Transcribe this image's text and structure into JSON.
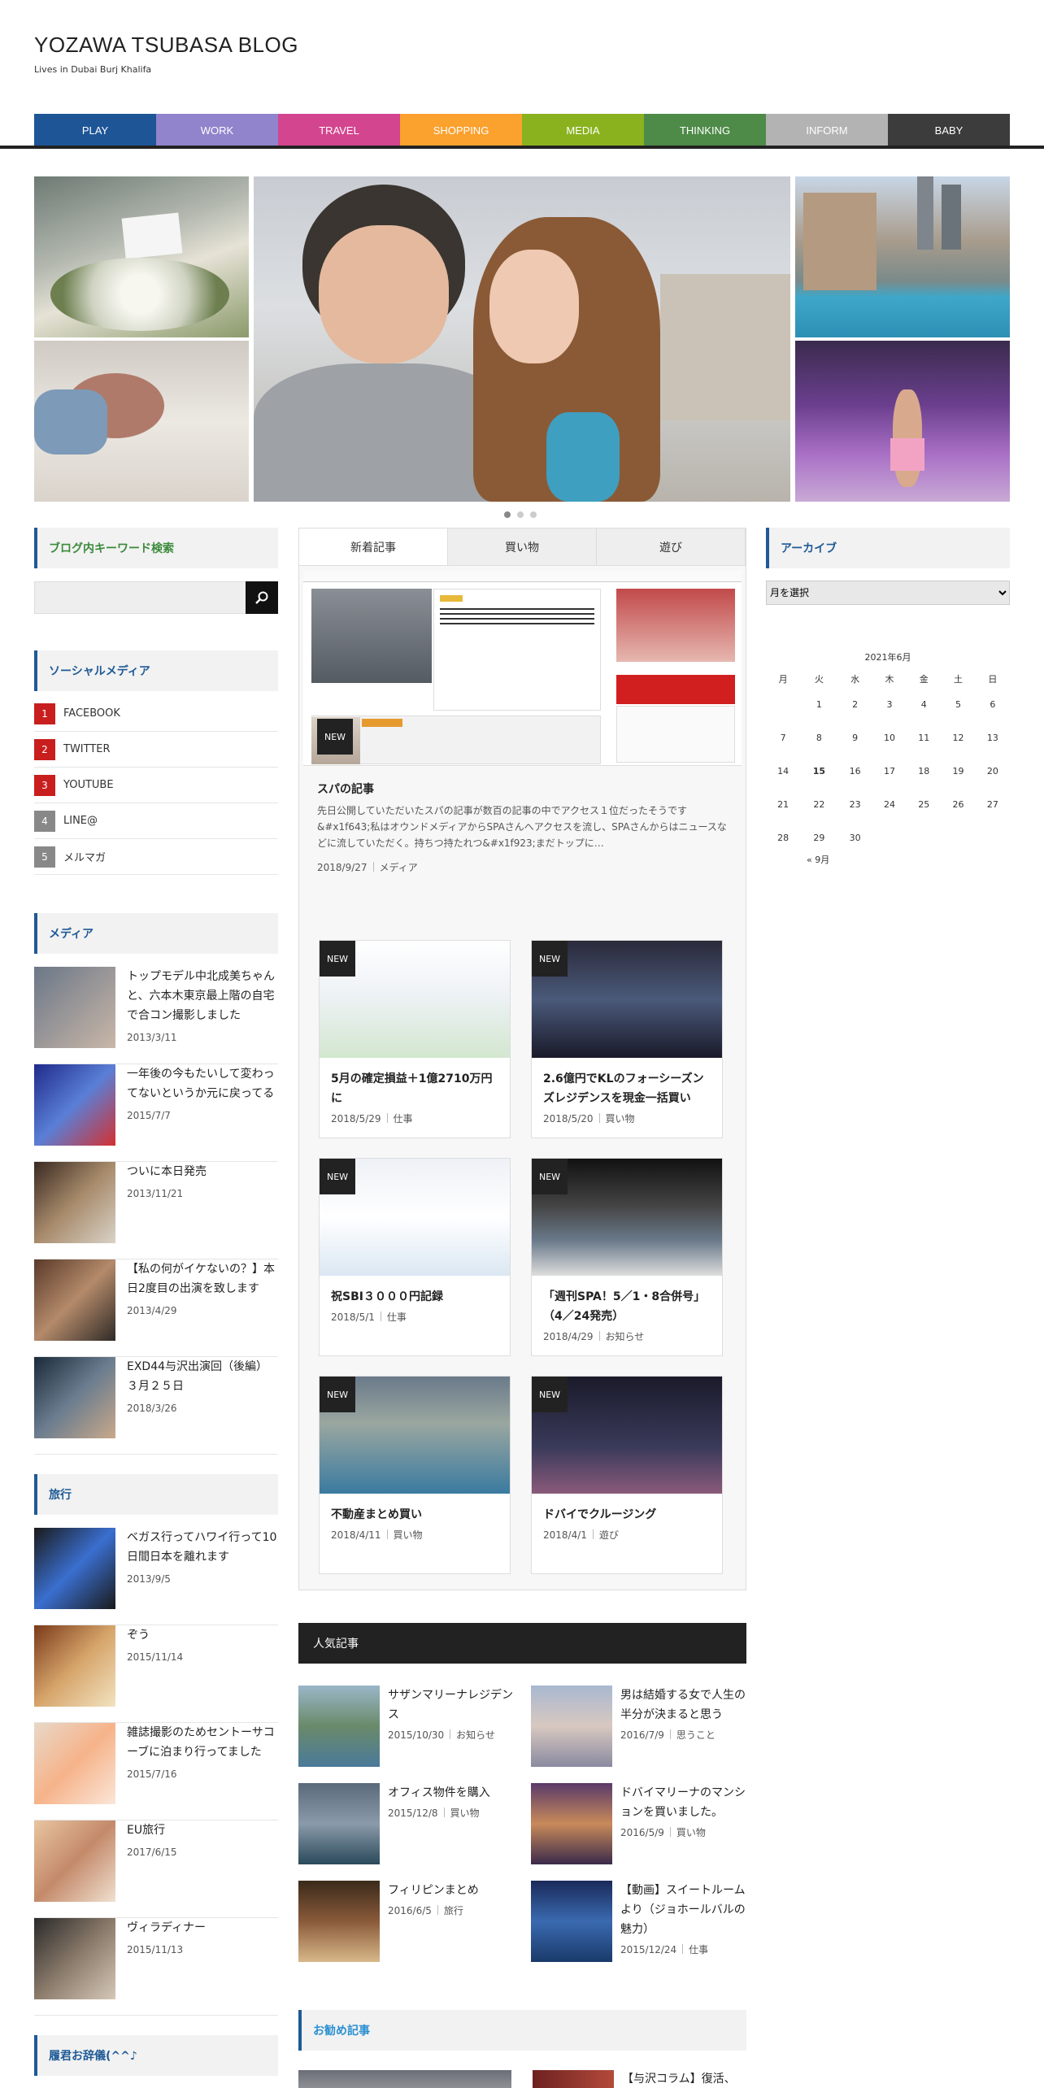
{
  "site": {
    "title": "YOZAWA TSUBASA BLOG",
    "tagline": "Lives in Dubai Burj Khalifa"
  },
  "nav": [
    {
      "label": "PLAY",
      "color": "#1e5596"
    },
    {
      "label": "WORK",
      "color": "#9184cc"
    },
    {
      "label": "TRAVEL",
      "color": "#d4458f"
    },
    {
      "label": "SHOPPING",
      "color": "#fba12e"
    },
    {
      "label": "MEDIA",
      "color": "#8ab21e"
    },
    {
      "label": "THINKING",
      "color": "#4e8a48"
    },
    {
      "label": "INFORM",
      "color": "#b3b3b3"
    },
    {
      "label": "BABY",
      "color": "#3c3c3c"
    }
  ],
  "slider": {
    "dots": 3,
    "active": 0
  },
  "search": {
    "title": "ブログ内キーワード検索",
    "placeholder": "",
    "button_icon": "search-icon"
  },
  "social": {
    "title": "ソーシャルメディア",
    "items": [
      {
        "num": "1",
        "label": "FACEBOOK",
        "color": "#c81e1e"
      },
      {
        "num": "2",
        "label": "TWITTER",
        "color": "#c81e1e"
      },
      {
        "num": "3",
        "label": "YOUTUBE",
        "color": "#c81e1e"
      },
      {
        "num": "4",
        "label": "LINE@",
        "color": "#888888"
      },
      {
        "num": "5",
        "label": "メルマガ",
        "color": "#888888"
      }
    ]
  },
  "media": {
    "title": "メディア",
    "items": [
      {
        "title": "トップモデル中北成美ちゃんと、六本木東京最上階の自宅で合コン撮影しました",
        "date": "2013/3/11"
      },
      {
        "title": "一年後の今もたいして変わってないというか元に戻ってる",
        "date": "2015/7/7"
      },
      {
        "title": "ついに本日発売",
        "date": "2013/11/21"
      },
      {
        "title": "【私の何がイケないの？】本日2度目の出演を致します",
        "date": "2013/4/29"
      },
      {
        "title": "EXD44与沢出演回（後編）３月２５日",
        "date": "2018/3/26"
      }
    ]
  },
  "travel": {
    "title": "旅行",
    "items": [
      {
        "title": "ベガス行ってハワイ行って10日間日本を離れます",
        "date": "2013/9/5"
      },
      {
        "title": "ぞう",
        "date": "2015/11/14"
      },
      {
        "title": "雑誌撮影のためセントーサコーブに泊まり行ってました",
        "date": "2015/7/16"
      },
      {
        "title": "EU旅行",
        "date": "2017/6/15"
      },
      {
        "title": "ヴィラディナー",
        "date": "2015/11/13"
      }
    ]
  },
  "bottom_left": {
    "title": "履君お辞儀(^^♪"
  },
  "tabs": [
    {
      "label": "新着記事",
      "active": true
    },
    {
      "label": "買い物",
      "active": false
    },
    {
      "label": "遊び",
      "active": false
    }
  ],
  "featured": {
    "badge": "NEW",
    "title": "スパの記事",
    "excerpt": "先日公開していただいたスパの記事が数百の記事の中でアクセス１位だったそうです &#x1f643;私はオウンドメディアからSPAさんへアクセスを流し、SPAさんからはニュースなどに流していただく。持ちつ持たれつ&#x1f923;まだトップに…",
    "date": "2018/9/27",
    "category": "メディア"
  },
  "cards": [
    {
      "badge": "NEW",
      "title": "5月の確定損益＋1億2710万円に",
      "date": "2018/5/29",
      "category": "仕事"
    },
    {
      "badge": "NEW",
      "title": "2.6億円でKLのフォーシーズンズレジデンスを現金一括買い",
      "date": "2018/5/20",
      "category": "買い物"
    },
    {
      "badge": "NEW",
      "title": "祝SBI３０００円記録",
      "date": "2018/5/1",
      "category": "仕事"
    },
    {
      "badge": "NEW",
      "title": "「週刊SPA！5／1・8合併号」（4／24発売）",
      "date": "2018/4/29",
      "category": "お知らせ"
    },
    {
      "badge": "NEW",
      "title": "不動産まとめ買い",
      "date": "2018/4/11",
      "category": "買い物"
    },
    {
      "badge": "NEW",
      "title": "ドバイでクルージング",
      "date": "2018/4/1",
      "category": "遊び"
    }
  ],
  "popular": {
    "title": "人気記事",
    "items": [
      {
        "title": "サザンマリーナレジデンス",
        "date": "2015/10/30",
        "category": "お知らせ"
      },
      {
        "title": "男は結婚する女で人生の半分が決まると思う",
        "date": "2016/7/9",
        "category": "思うこと"
      },
      {
        "title": "オフィス物件を購入",
        "date": "2015/12/8",
        "category": "買い物"
      },
      {
        "title": "ドバイマリーナのマンションを買いました。",
        "date": "2016/5/9",
        "category": "買い物"
      },
      {
        "title": "フィリピンまとめ",
        "date": "2016/6/5",
        "category": "旅行"
      },
      {
        "title": "【動画】スイートルームより（ジョホールバルの魅力）",
        "date": "2015/12/24",
        "category": "仕事"
      }
    ]
  },
  "recommended": {
    "title": "お勧め記事",
    "peek": "【与沢コラム】復活、"
  },
  "archive": {
    "title": "アーカイブ",
    "select": "月を選択"
  },
  "calendar": {
    "caption": "2021年6月",
    "headers": [
      "月",
      "火",
      "水",
      "木",
      "金",
      "土",
      "日"
    ],
    "weeks": [
      [
        "",
        "1",
        "2",
        "3",
        "4",
        "5",
        "6"
      ],
      [
        "7",
        "8",
        "9",
        "10",
        "11",
        "12",
        "13"
      ],
      [
        "14",
        "15",
        "16",
        "17",
        "18",
        "19",
        "20"
      ],
      [
        "21",
        "22",
        "23",
        "24",
        "25",
        "26",
        "27"
      ],
      [
        "28",
        "29",
        "30",
        "",
        "",
        "",
        ""
      ]
    ],
    "bold_day": "15",
    "prev": "« 9月"
  }
}
